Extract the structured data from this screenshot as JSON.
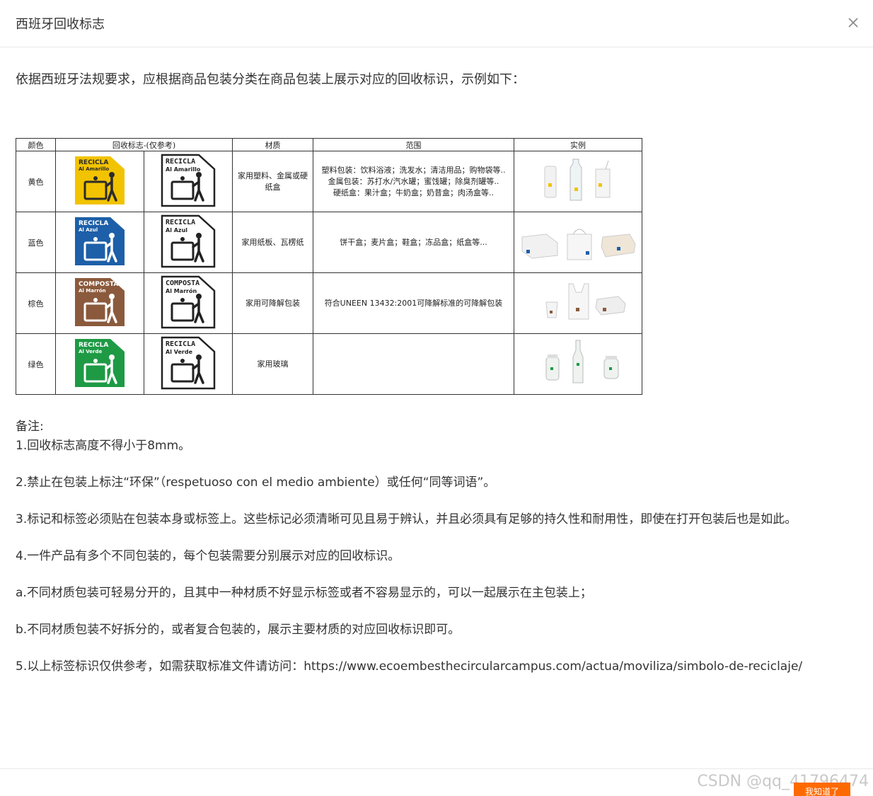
{
  "dialog": {
    "title": "西班牙回收标志",
    "close_icon": "close-icon"
  },
  "intro": "依据西班牙法规要求，应根据商品包装分类在商品包装上展示对应的回收标识，示例如下：",
  "table": {
    "headers": [
      "颜色",
      "回收标志-(仅参考)",
      "材质",
      "范围",
      "实例"
    ],
    "rows": [
      {
        "color_name": "黄色",
        "logo_line1": "RECICLA",
        "logo_line2": "Al Amarillo",
        "logo_color": "#f2c300",
        "logo_text_color": "#2b2b2b",
        "material": "家用塑料、金属或硬纸盒",
        "scope_lines": [
          "塑料包装：饮料浴液；洗发水；清洁用品；购物袋等..",
          "金属包装：苏打水/汽水罐；蜜饯罐；除臭剂罐等..",
          "硬纸盒：果汁盒；牛奶盒；奶昔盒；肉汤盒等.."
        ],
        "example": "yellow-examples"
      },
      {
        "color_name": "蓝色",
        "logo_line1": "RECICLA",
        "logo_line2": "Al Azul",
        "logo_color": "#1d5fa8",
        "logo_text_color": "#ffffff",
        "material": "家用纸板、瓦楞纸",
        "scope_lines": [
          "饼干盒；麦片盒；鞋盒；冻品盒；纸盒等..."
        ],
        "example": "blue-examples"
      },
      {
        "color_name": "棕色",
        "logo_line1": "COMPOSTA",
        "logo_line2": "Al Marrón",
        "logo_color": "#8b5a3c",
        "logo_text_color": "#ffffff",
        "material": "家用可降解包装",
        "scope_lines": [
          "符合UNEEN 13432:2001可降解标准的可降解包装"
        ],
        "example": "brown-examples"
      },
      {
        "color_name": "绿色",
        "logo_line1": "RECICLA",
        "logo_line2": "Al Verde",
        "logo_color": "#1e9a45",
        "logo_text_color": "#ffffff",
        "material": "家用玻璃",
        "scope_lines": [],
        "example": "green-examples"
      }
    ]
  },
  "notes": {
    "heading": "备注:",
    "n1": "1.回收标志高度不得小于8mm。",
    "n2": "2.禁止在包装上标注“环保”（respetuoso con el medio ambiente）或任何“同等词语”。",
    "n3": "3.标记和标签必须贴在包装本身或标签上。这些标记必须清晰可见且易于辨认，并且必须具有足够的持久性和耐用性，即使在打开包装后也是如此。",
    "n4": "4.一件产品有多个不同包装的，每个包装需要分别展示对应的回收标识。",
    "na": "a.不同材质包装可轻易分开的，且其中一种材质不好显示标签或者不容易显示的，可以一起展示在主包装上；",
    "nb": "b.不同材质包装不好拆分的，或者复合包装的，展示主要材质的对应回收标识即可。",
    "n5": "5.以上标签标识仅供参考，如需获取标准文件请访问：https://www.ecoembesthecircularcampus.com/actua/moviliza/simbolo-de-reciclaje/"
  },
  "footer": {
    "ok_label": "我知道了",
    "watermark": "CSDN @qq_41796474"
  }
}
